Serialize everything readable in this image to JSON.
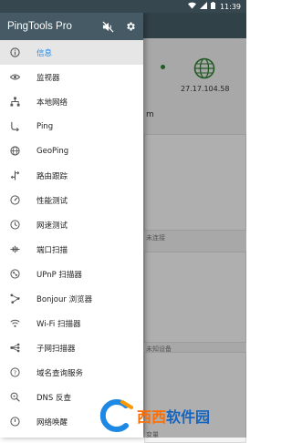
{
  "statusbar": {
    "time": "11:39"
  },
  "drawer": {
    "title": "PingTools Pro",
    "items": [
      {
        "label": "信息",
        "icon": "info-icon",
        "active": true
      },
      {
        "label": "监视器",
        "icon": "eye-icon"
      },
      {
        "label": "本地网络",
        "icon": "network-tree-icon"
      },
      {
        "label": "Ping",
        "icon": "ping-icon"
      },
      {
        "label": "GeoPing",
        "icon": "globe-icon"
      },
      {
        "label": "路由跟踪",
        "icon": "route-icon"
      },
      {
        "label": "性能测试",
        "icon": "speedometer-icon"
      },
      {
        "label": "网速测试",
        "icon": "speed-test-icon"
      },
      {
        "label": "端口扫描",
        "icon": "port-scan-icon"
      },
      {
        "label": "UPnP 扫描器",
        "icon": "upnp-icon"
      },
      {
        "label": "Bonjour 浏览器",
        "icon": "bonjour-icon"
      },
      {
        "label": "Wi-Fi 扫描器",
        "icon": "wifi-icon"
      },
      {
        "label": "子网扫描器",
        "icon": "subnet-icon"
      },
      {
        "label": "域名查询服务",
        "icon": "whois-icon"
      },
      {
        "label": "DNS 反查",
        "icon": "dns-search-icon"
      },
      {
        "label": "网络唤醒",
        "icon": "wake-power-icon"
      }
    ]
  },
  "background": {
    "ip_address": "27.17.104.58",
    "partial_label": "m",
    "card1_label": "未连接",
    "card2_label": "未知设备",
    "card3_label": "变量"
  },
  "watermark": {
    "text_a": "西西",
    "text_b": "软件园"
  },
  "colors": {
    "primary": "#455a64",
    "accent": "#1e88e5",
    "active_bg": "#e6e6e6"
  }
}
